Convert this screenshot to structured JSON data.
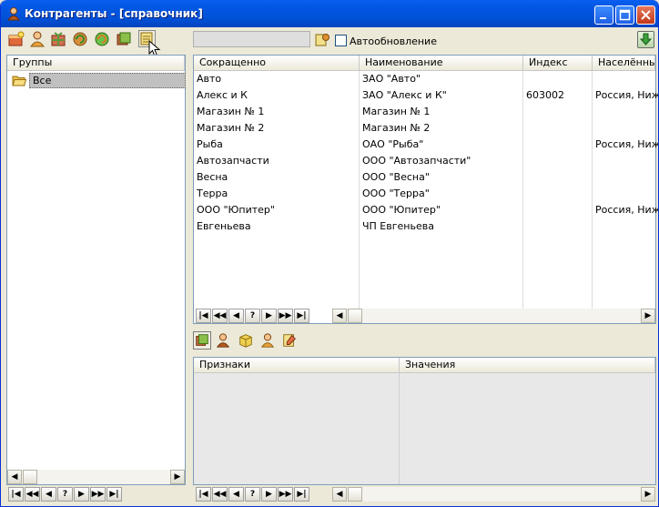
{
  "window": {
    "title": "Контрагенты - [справочник]"
  },
  "toolbar": {
    "icons": [
      "add-icon",
      "user-icon",
      "gift-box-icon",
      "refresh-icon",
      "sync-icon",
      "cards-icon",
      "edit-list-icon"
    ],
    "search_value": "",
    "autorefresh_label": "Автообновление",
    "autorefresh_checked": false
  },
  "groups": {
    "header": "Группы",
    "items": [
      {
        "label": "Все",
        "selected": true
      }
    ]
  },
  "table": {
    "columns": [
      "Сокращенно",
      "Наименование",
      "Индекс",
      "Населённые"
    ],
    "rows": [
      [
        "Авто",
        "ЗАО \"Авто\"",
        "",
        ""
      ],
      [
        "Алекс и К",
        "ЗАО \"Алекс и К\"",
        "603002",
        "Россия, Ниж"
      ],
      [
        "Магазин № 1",
        "Магазин № 1",
        "",
        ""
      ],
      [
        "Магазин № 2",
        "Магазин № 2",
        "",
        ""
      ],
      [
        "Рыба",
        "ОАО \"Рыба\"",
        "",
        "Россия, Ниж"
      ],
      [
        "Автозапчасти",
        "ООО \"Автозапчасти\"",
        "",
        ""
      ],
      [
        "Весна",
        "ООО \"Весна\"",
        "",
        ""
      ],
      [
        "Терра",
        "ООО \"Терра\"",
        "",
        ""
      ],
      [
        "ООО \"Юпитер\"",
        "ООО \"Юпитер\"",
        "",
        "Россия, Ниж"
      ],
      [
        "Евгеньева",
        "ЧП Евгеньева",
        "",
        ""
      ]
    ]
  },
  "navigator": {
    "buttons": [
      "|◀",
      "◀◀",
      "◀",
      "?",
      "▶",
      "▶▶",
      "▶|"
    ]
  },
  "details": {
    "tab_icons": [
      "cards-icon",
      "person-icon",
      "box-icon",
      "user-icon",
      "notes-icon"
    ],
    "columns": [
      "Признаки",
      "Значения"
    ]
  },
  "colors": {
    "titlebar": "#0458e6",
    "selected_row": "#c0c0c0",
    "panel_border": "#7f9db9",
    "details_bg": "#e8e8e8"
  }
}
